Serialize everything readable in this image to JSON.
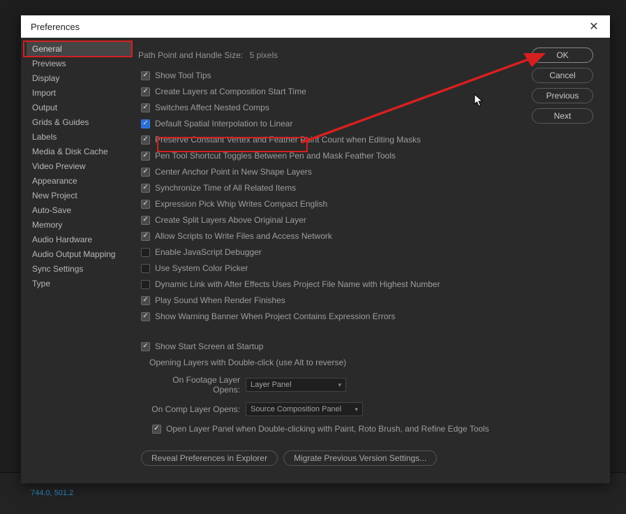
{
  "dialog": {
    "title": "Preferences",
    "close": "✕"
  },
  "sidebar": {
    "items": [
      {
        "label": "General",
        "active": true
      },
      {
        "label": "Previews"
      },
      {
        "label": "Display"
      },
      {
        "label": "Import"
      },
      {
        "label": "Output"
      },
      {
        "label": "Grids & Guides"
      },
      {
        "label": "Labels"
      },
      {
        "label": "Media & Disk Cache"
      },
      {
        "label": "Video Preview"
      },
      {
        "label": "Appearance"
      },
      {
        "label": "New Project"
      },
      {
        "label": "Auto-Save"
      },
      {
        "label": "Memory"
      },
      {
        "label": "Audio Hardware"
      },
      {
        "label": "Audio Output Mapping"
      },
      {
        "label": "Sync Settings"
      },
      {
        "label": "Type"
      }
    ]
  },
  "buttons": {
    "ok": "OK",
    "cancel": "Cancel",
    "previous": "Previous",
    "next": "Next"
  },
  "path_point": {
    "label": "Path Point and Handle Size:",
    "value": "5 pixels"
  },
  "options": [
    {
      "label": "Show Tool Tips",
      "checked": true
    },
    {
      "label": "Create Layers at Composition Start Time",
      "checked": true
    },
    {
      "label": "Switches Affect Nested Comps",
      "checked": true
    },
    {
      "label": "Default Spatial Interpolation to Linear",
      "checked": true,
      "highlighted": true
    },
    {
      "label": "Preserve Constant Vertex and Feather Point Count when Editing Masks",
      "checked": true
    },
    {
      "label": "Pen Tool Shortcut Toggles Between Pen and Mask Feather Tools",
      "checked": true
    },
    {
      "label": "Center Anchor Point in New Shape Layers",
      "checked": true
    },
    {
      "label": "Synchronize Time of All Related Items",
      "checked": true
    },
    {
      "label": "Expression Pick Whip Writes Compact English",
      "checked": true
    },
    {
      "label": "Create Split Layers Above Original Layer",
      "checked": true
    },
    {
      "label": "Allow Scripts to Write Files and Access Network",
      "checked": true
    },
    {
      "label": "Enable JavaScript Debugger",
      "checked": false
    },
    {
      "label": "Use System Color Picker",
      "checked": false
    },
    {
      "label": "Dynamic Link with After Effects Uses Project File Name with Highest Number",
      "checked": false
    },
    {
      "label": "Play Sound When Render Finishes",
      "checked": true
    },
    {
      "label": "Show Warning Banner When Project Contains Expression Errors",
      "checked": true
    }
  ],
  "startup": {
    "show": {
      "label": "Show Start Screen at Startup",
      "checked": true
    },
    "subtitle": "Opening Layers with Double-click (use Alt to reverse)",
    "footageRow": {
      "label": "On Footage Layer Opens:",
      "value": "Layer Panel"
    },
    "compRow": {
      "label": "On Comp Layer Opens:",
      "value": "Source Composition Panel"
    },
    "openLayer": {
      "label": "Open Layer Panel when Double-clicking with Paint, Roto Brush, and Refine Edge Tools",
      "checked": true
    }
  },
  "bottom": {
    "reveal": "Reveal Preferences in Explorer",
    "migrate": "Migrate Previous Version Settings..."
  },
  "bg": {
    "coords": "744.0, 501.2"
  }
}
